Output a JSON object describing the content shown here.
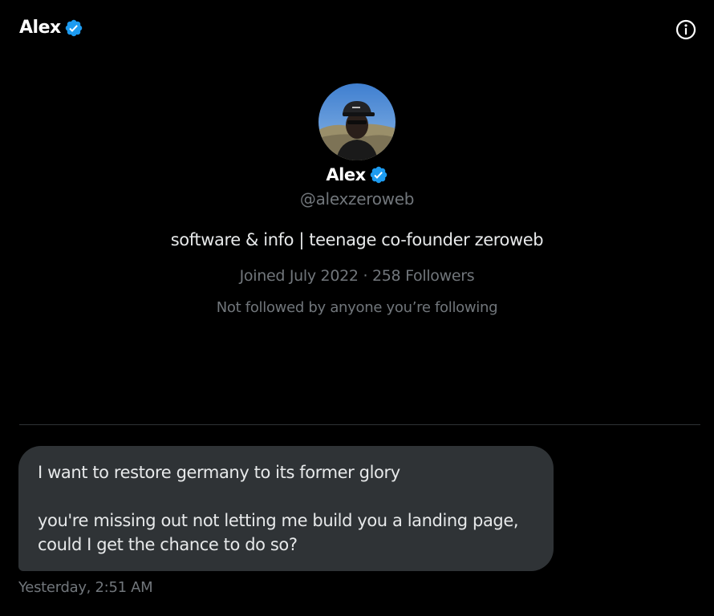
{
  "header": {
    "title": "Alex",
    "verified_icon": "verified-badge-icon",
    "info_icon": "info-icon"
  },
  "profile": {
    "name": "Alex",
    "handle": "@alexzeroweb",
    "bio": "software & info | teenage co-founder zeroweb",
    "joined": "Joined July 2022",
    "separator": "·",
    "followers": "258 Followers",
    "mutuals": "Not followed by anyone you’re following"
  },
  "message": {
    "line1": "I want to restore germany to its former glory",
    "line2": "you're missing out not letting me build you a landing page,",
    "line3": "could I get the chance to do so?",
    "timestamp": "Yesterday, 2:51 AM"
  },
  "colors": {
    "background": "#000000",
    "primary_text": "#e7e9ea",
    "secondary_text": "#71767b",
    "bubble": "#2f3336",
    "verified_blue": "#1d9bf0"
  }
}
